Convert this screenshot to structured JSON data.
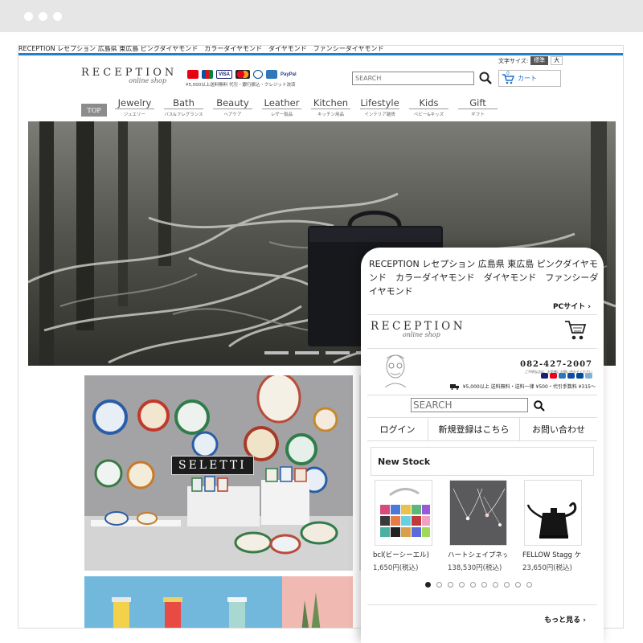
{
  "desktop": {
    "announcement": "RECEPTION レセプション 広島県 東広島 ピンクダイヤモンド　カラーダイヤモンド　ダイヤモンド　ファンシーダイヤモンド",
    "font_size_label": "文字サイズ:",
    "font_size_options": [
      "標準",
      "大"
    ],
    "logo_main": "RECEPTION",
    "logo_sub": "online shop",
    "payment_icons": [
      "paypay-icon",
      "jcb-icon",
      "visa-icon",
      "mastercard-icon",
      "diners-icon",
      "amex-icon",
      "paypal-icon"
    ],
    "payment_note": "¥5,000以上送料無料 代引・銀行振込・クレジット決済",
    "search_placeholder": "SEARCH",
    "cart_label": "カート",
    "cart_count": "0",
    "top_button": "TOP",
    "nav": [
      {
        "en": "Jewelry",
        "jp": "ジュエリー"
      },
      {
        "en": "Bath",
        "jp": "バス&フレグランス"
      },
      {
        "en": "Beauty",
        "jp": "ヘアケア"
      },
      {
        "en": "Leather",
        "jp": "レザー製品"
      },
      {
        "en": "Kitchen",
        "jp": "キッチン用品"
      },
      {
        "en": "Lifestyle",
        "jp": "インテリア雑貨"
      },
      {
        "en": "Kids",
        "jp": "ベビー&キッズ"
      },
      {
        "en": "Gift",
        "jp": "ギフト"
      }
    ],
    "seletti_logo": "SELETTI",
    "colors": {
      "accent_blue": "#1f7fd1",
      "top_button": "#8c8c8c"
    }
  },
  "mobile": {
    "announcement": "RECEPTION レセプション 広島県 東広島 ピンクダイヤモンド　カラーダイヤモンド　ダイヤモンド　ファンシーダイヤモンド",
    "pc_site": "PCサイト",
    "logo_main": "RECEPTION",
    "logo_sub": "online shop",
    "phone": "082-427-2007",
    "phone_note": "ご不明な点は、お気軽にお問い合わせください",
    "shipping": "¥5,000以上 送料無料・送料一律 ¥500・代引手数料 ¥315〜",
    "search_placeholder": "SEARCH",
    "menu": [
      "ログイン",
      "新規登録はこちら",
      "お問い合わせ"
    ],
    "new_stock_title": "New Stock",
    "products": [
      {
        "name": "bcl(ビーシーエル)",
        "price": "1,650円(税込)"
      },
      {
        "name": "ハートシェイプネックレス",
        "price": "138,530円(税込)"
      },
      {
        "name": "FELLOW Stagg ケトル",
        "price": "23,650円(税込)"
      }
    ],
    "carousel_dot_count": 10,
    "carousel_active_index": 0,
    "more": "もっと見る"
  }
}
